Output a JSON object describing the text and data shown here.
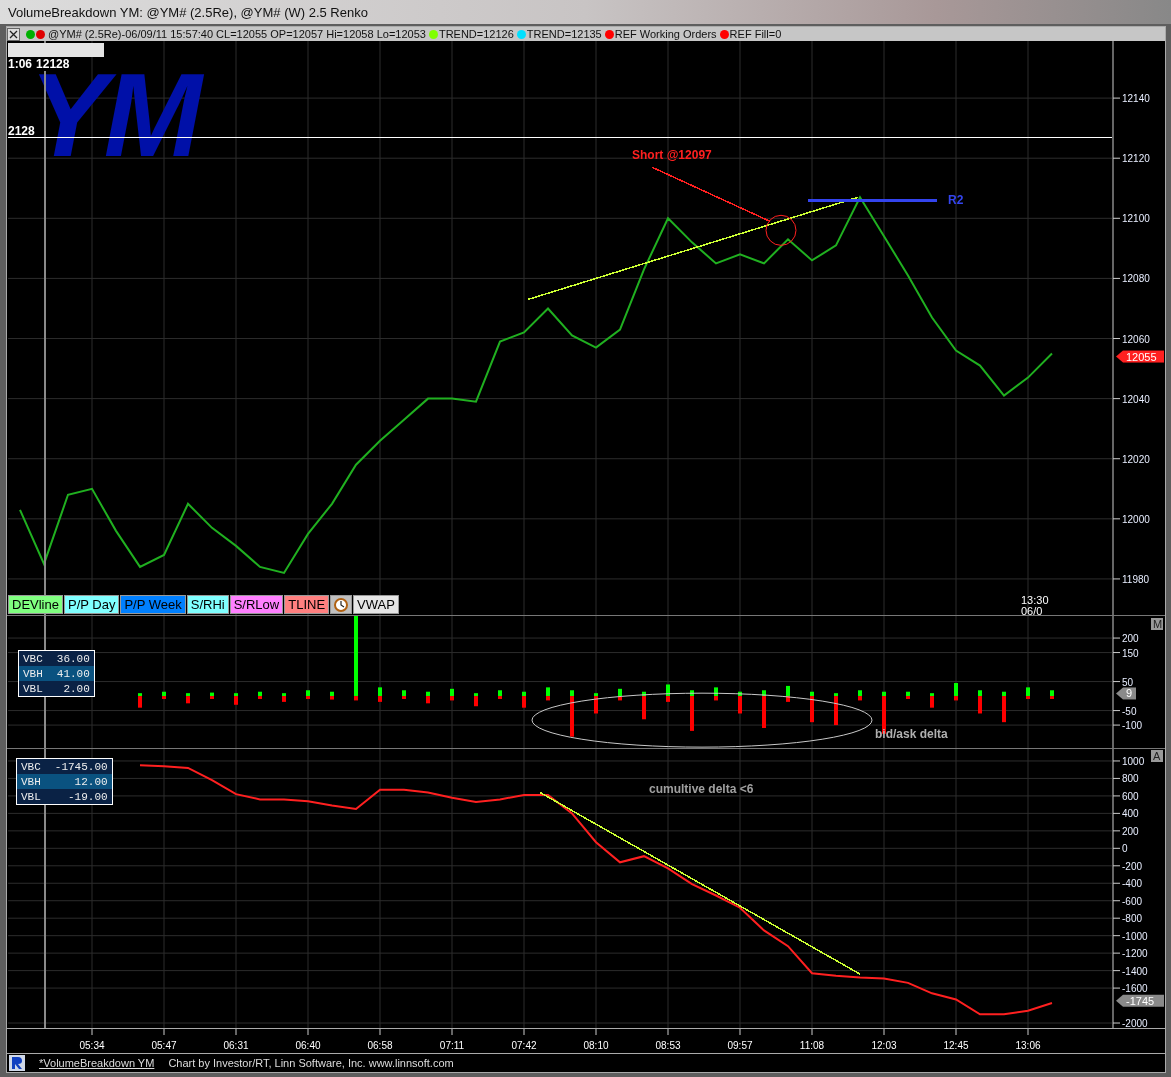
{
  "window": {
    "title": "VolumeBreakdown YM: @YM# (2.5Re), @YM# (W) 2.5 Renko"
  },
  "header": {
    "symbol_dots": [
      {
        "color": "#00b000"
      },
      {
        "color": "#e00000"
      }
    ],
    "quote": "@YM# (2.5Re)-06/09/11 15:57:40 CL=12055 OP=12057 Hi=12058 Lo=12053",
    "indicators": [
      {
        "text": "TREND=12126",
        "color": "#80ff00"
      },
      {
        "text": "TREND=12135",
        "color": "#00e0ff"
      },
      {
        "text": "REF Working Orders",
        "color": "#ff0000"
      },
      {
        "text": "REF Fill=0",
        "color": "#ff0000"
      }
    ]
  },
  "price_panel": {
    "symbol_overlay": "YM",
    "crosshair_readout": {
      "time": "1:06",
      "value": "12128"
    },
    "crosshair_label": "2128",
    "last_bar_time": [
      "13:30",
      "06/0"
    ],
    "buttons": [
      {
        "kind": "text",
        "label": "DEVline",
        "color": "#80ff80"
      },
      {
        "kind": "text",
        "label": "P/P Day",
        "color": "#80ffff"
      },
      {
        "kind": "text",
        "label": "P/P Week",
        "color": "#0080ff"
      },
      {
        "kind": "text",
        "label": "S/RHi",
        "color": "#80ffff"
      },
      {
        "kind": "text",
        "label": "S/RLow",
        "color": "#ff80ff"
      },
      {
        "kind": "text",
        "label": "TLINE",
        "color": "#ff8080"
      },
      {
        "kind": "clock",
        "color": "#c0c0c0"
      },
      {
        "kind": "text",
        "label": "VWAP",
        "color": "#e6e6e6"
      }
    ],
    "chart_data": {
      "type": "line",
      "grid": true,
      "ylim": [
        11968,
        12159
      ],
      "yticks": [
        11980,
        12000,
        12020,
        12040,
        12060,
        12080,
        12100,
        12120,
        12140
      ],
      "categories": [
        null,
        null,
        null,
        null,
        null,
        null,
        null,
        null,
        null,
        null,
        null,
        null,
        null,
        null,
        null,
        null,
        null,
        null,
        null,
        null,
        null,
        null,
        null,
        null,
        null,
        null,
        null,
        null,
        null,
        null,
        null,
        null,
        null,
        null,
        null,
        null,
        null,
        null,
        null,
        null,
        null,
        null,
        null,
        null,
        null,
        null
      ],
      "series": [
        {
          "color": "#20b020",
          "values": [
            12003,
            11985,
            12008,
            12010,
            11996,
            11984,
            11988,
            12005,
            11997,
            11991,
            11984,
            11982,
            11995,
            12005,
            12018,
            12026,
            12033,
            12040,
            12040,
            12039,
            12059,
            12062,
            12070,
            12061,
            12057,
            12063,
            12083,
            12100,
            12092,
            12085,
            12088,
            12085,
            12093,
            12086,
            12091,
            12107,
            12094,
            12081,
            12067,
            12056,
            12051,
            12041,
            12047,
            12055,
            null,
            null
          ]
        }
      ]
    },
    "overlays": [
      {
        "kind": "line",
        "color": "#ccff33"
      },
      {
        "kind": "hline",
        "color": "#3344ee",
        "label": "R2"
      },
      {
        "kind": "line",
        "color": "#ff2020"
      },
      {
        "kind": "ellipse",
        "color": "#ff2020"
      },
      {
        "kind": "text",
        "text": "Short @12097",
        "color": "#ff2020"
      },
      {
        "kind": "tag",
        "text": "12055",
        "color": "#ff2020"
      }
    ]
  },
  "delta_panel": {
    "box_label": "M",
    "readout": [
      {
        "label": "VBC",
        "value": "36.00"
      },
      {
        "label": "VBH",
        "value": "41.00"
      },
      {
        "label": "VBL",
        "value": "2.00"
      }
    ],
    "chart_data": {
      "type": "bar",
      "stacked": true,
      "grid": true,
      "ylim": [
        -179,
        276
      ],
      "yticks": [
        200,
        150,
        50,
        -50,
        -100
      ],
      "categories": [
        null,
        null,
        null,
        null,
        null,
        null,
        null,
        null,
        null,
        null,
        null,
        null,
        null,
        null,
        null,
        null,
        null,
        null,
        null,
        null,
        null,
        null,
        null,
        null,
        null,
        null,
        null,
        null,
        null,
        null,
        null,
        null,
        null,
        null,
        null,
        null,
        null,
        null,
        null,
        null,
        null,
        null,
        null,
        null,
        null,
        null
      ],
      "series": [
        {
          "color": "#00ff00",
          "values": [
            null,
            null,
            null,
            null,
            null,
            10,
            15,
            10,
            12,
            10,
            15,
            10,
            20,
            15,
            276,
            30,
            20,
            15,
            25,
            10,
            20,
            15,
            30,
            20,
            10,
            25,
            15,
            40,
            20,
            30,
            15,
            20,
            35,
            15,
            10,
            20,
            15,
            15,
            10,
            45,
            20,
            15,
            30,
            20,
            null,
            null
          ]
        },
        {
          "color": "#ff0000",
          "values": [
            null,
            null,
            null,
            null,
            null,
            -40,
            -10,
            -25,
            -10,
            -30,
            -10,
            -20,
            -10,
            -12,
            -15,
            -20,
            -10,
            -25,
            -15,
            -35,
            -10,
            -40,
            -15,
            -140,
            -60,
            -15,
            -80,
            -20,
            -120,
            -15,
            -60,
            -110,
            -20,
            -90,
            -100,
            -15,
            -130,
            -10,
            -40,
            -15,
            -60,
            -90,
            -10,
            -10,
            null,
            null
          ]
        }
      ]
    },
    "overlays": [
      {
        "kind": "ellipse",
        "color": "#c8c8c8"
      },
      {
        "kind": "text",
        "text": "bid/ask delta",
        "color": "#b0b0b0"
      },
      {
        "kind": "tag",
        "text": "9",
        "color": "#8a8a8a"
      }
    ]
  },
  "cumulative_panel": {
    "box_label": "A",
    "readout": [
      {
        "label": "VBC",
        "value": "-1745.00"
      },
      {
        "label": "VBH",
        "value": "12.00"
      },
      {
        "label": "VBL",
        "value": "-19.00"
      }
    ],
    "chart_data": {
      "type": "line",
      "grid": true,
      "ylim": [
        -2057,
        1137
      ],
      "yticks": [
        1000,
        800,
        600,
        400,
        200,
        0,
        -200,
        -400,
        -600,
        -800,
        -1000,
        -1200,
        -1400,
        -1600,
        -2000
      ],
      "categories": [
        null,
        null,
        null,
        "05:34",
        null,
        null,
        "05:47",
        null,
        null,
        "06:31",
        null,
        null,
        "06:40",
        null,
        null,
        "06:58",
        null,
        null,
        "07:11",
        null,
        null,
        "07:42",
        null,
        null,
        "08:10",
        null,
        null,
        "08:53",
        null,
        null,
        "09:57",
        null,
        null,
        "11:08",
        null,
        null,
        "12:03",
        null,
        null,
        "12:45",
        null,
        null,
        "13:06",
        null,
        null,
        null
      ],
      "series": [
        {
          "color": "#ff2020",
          "values": [
            null,
            null,
            null,
            null,
            null,
            950,
            940,
            920,
            780,
            620,
            560,
            560,
            540,
            490,
            450,
            670,
            670,
            640,
            580,
            530,
            560,
            610,
            610,
            400,
            70,
            -160,
            -90,
            -230,
            -410,
            -540,
            -680,
            -940,
            -1120,
            -1430,
            -1460,
            -1480,
            -1490,
            -1540,
            -1660,
            -1730,
            -1900,
            -1900,
            -1860,
            -1770,
            null,
            null
          ]
        }
      ]
    },
    "overlays": [
      {
        "kind": "line",
        "color": "#ccff33"
      },
      {
        "kind": "text",
        "text": "cumultive delta <6",
        "color": "#a0a0a0"
      },
      {
        "kind": "tag",
        "text": "-1745",
        "color": "#8a8a8a"
      }
    ]
  },
  "footer": {
    "link": "*VolumeBreakdown YM",
    "credit": "Chart by Investor/RT, Linn Software, Inc. www.linnsoft.com"
  }
}
